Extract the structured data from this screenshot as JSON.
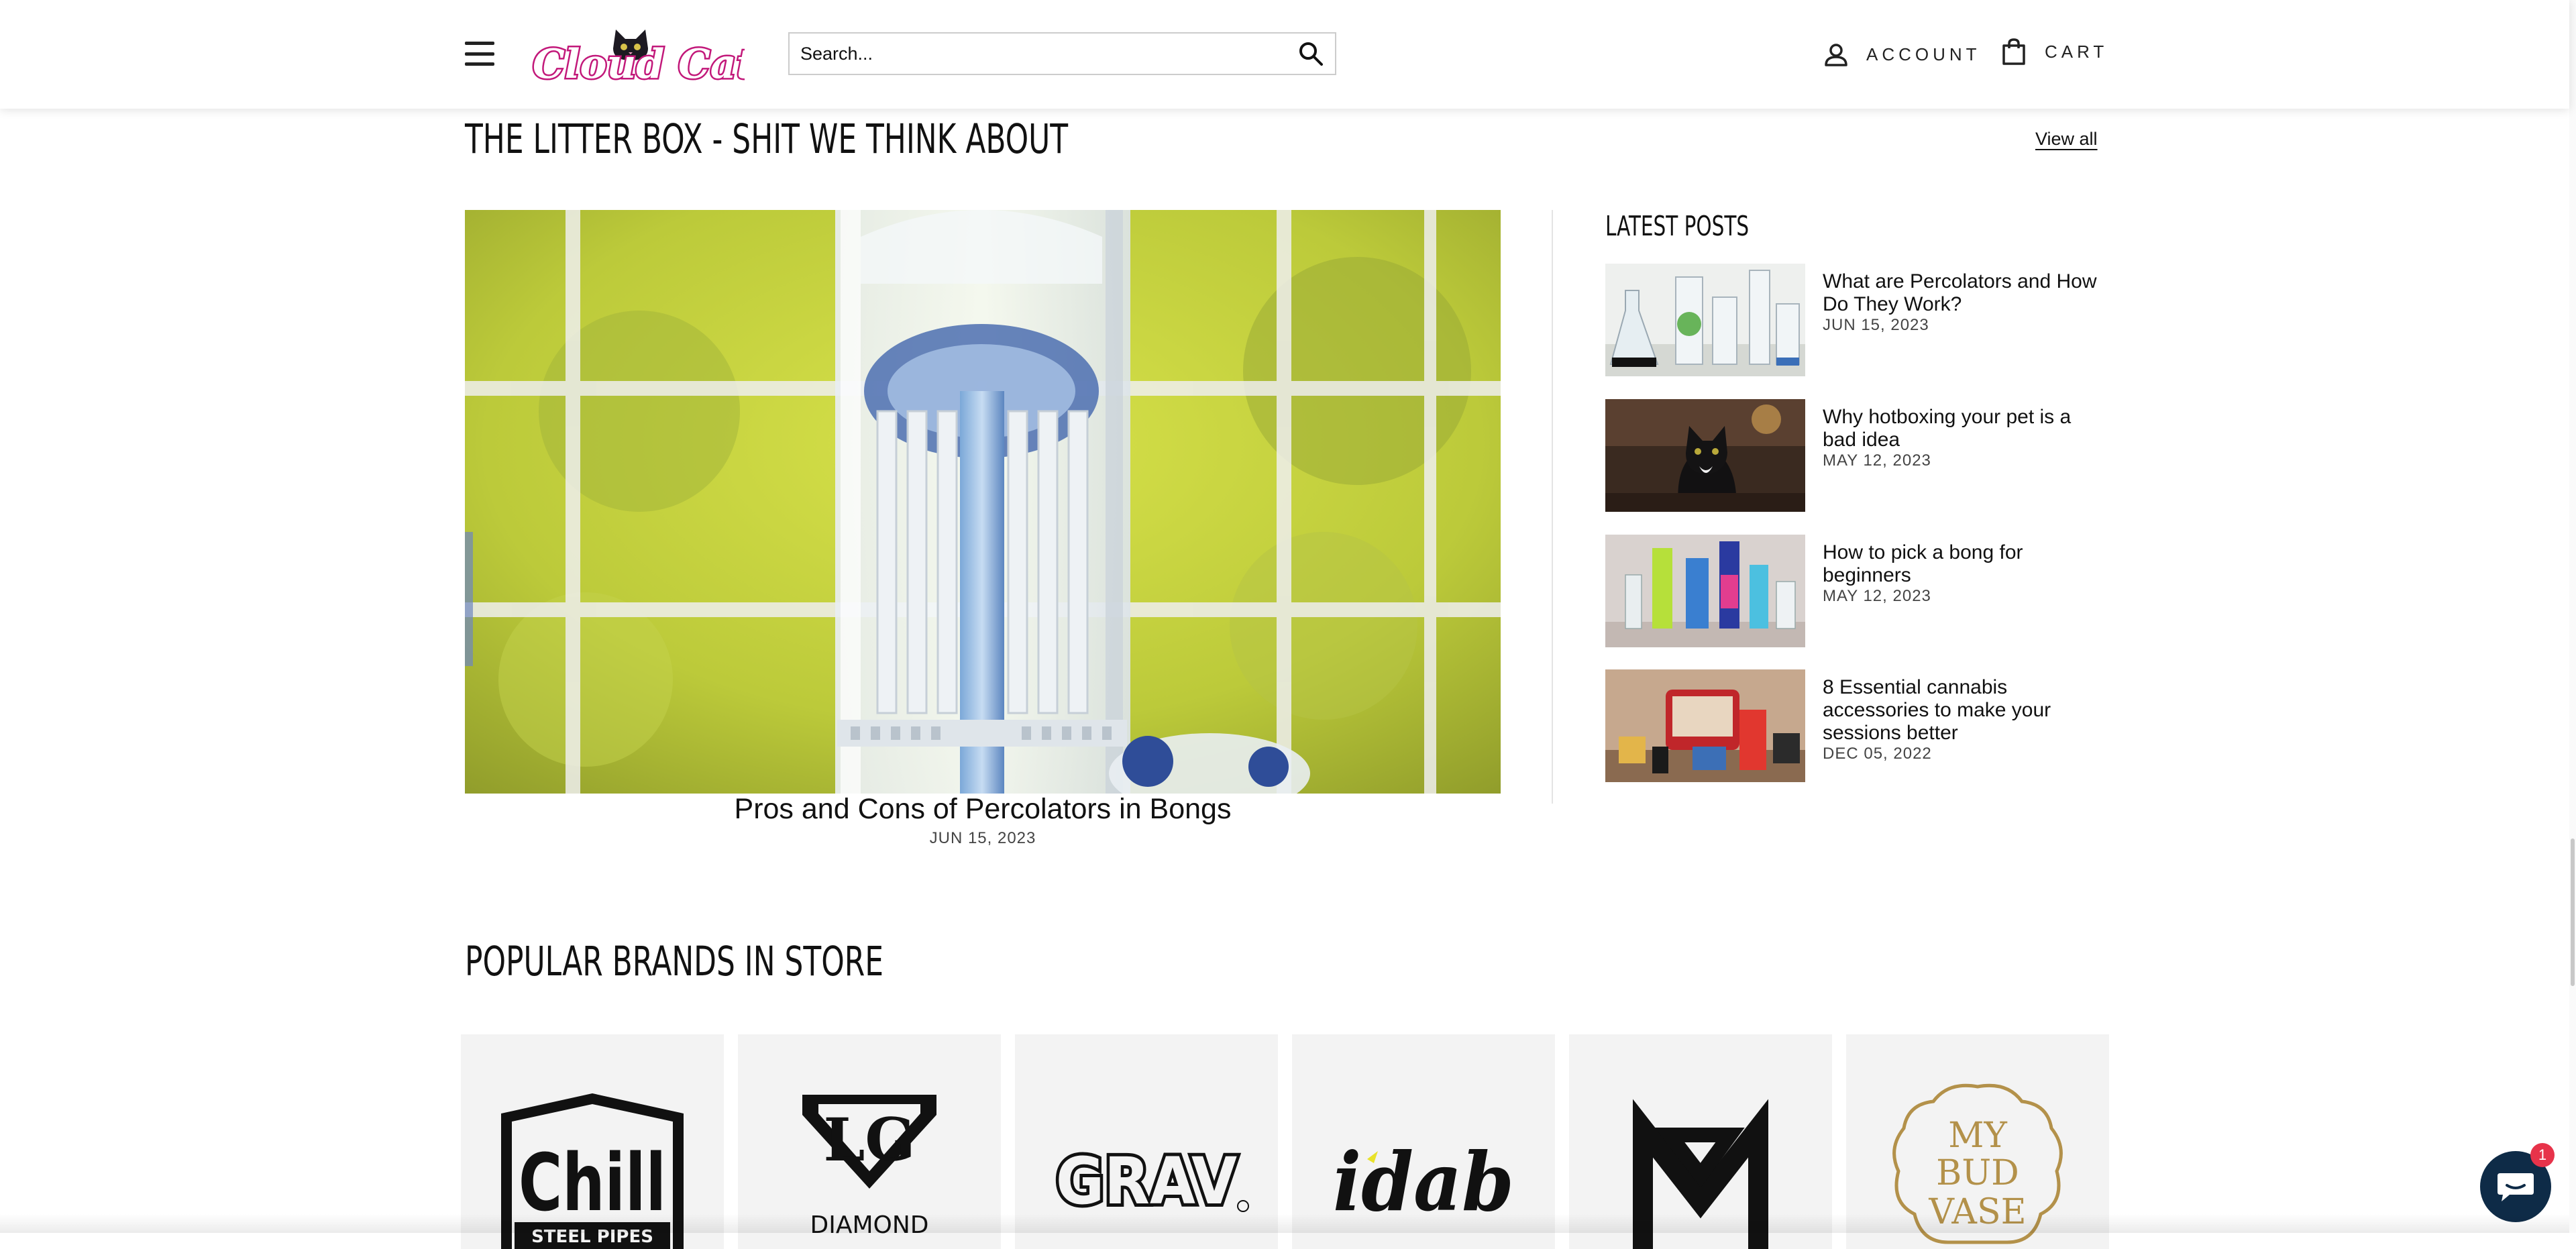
{
  "header": {
    "logo_text": "Cloud Cat",
    "search_placeholder": "Search...",
    "account_label": "ACCOUNT",
    "cart_label": "CART"
  },
  "blog": {
    "title": "THE LITTER BOX - SHIT WE THINK ABOUT",
    "view_all": "View all",
    "featured": {
      "title": "Pros and Cons of Percolators in Bongs",
      "date": "JUN 15, 2023"
    },
    "latest_title": "LATEST POSTS",
    "posts": [
      {
        "title": "What are Percolators and How Do They Work?",
        "date": "JUN 15, 2023"
      },
      {
        "title": "Why hotboxing your pet is a bad idea",
        "date": "MAY 12, 2023"
      },
      {
        "title": "How to pick a bong for beginners",
        "date": "MAY 12, 2023"
      },
      {
        "title": "8 Essential cannabis accessories to make your sessions better",
        "date": "DEC 05, 2022"
      }
    ]
  },
  "brands": {
    "title": "POPULAR BRANDS IN STORE",
    "items": [
      {
        "name": "chill",
        "text_main": "Chill",
        "text_sub": "STEEL PIPES"
      },
      {
        "name": "diamond-glass",
        "text_main": "LG",
        "text_sub": "DIAMOND"
      },
      {
        "name": "grav",
        "text_main": "GRAV",
        "text_sub": ""
      },
      {
        "name": "idab",
        "text_main": "idab",
        "text_sub": ""
      },
      {
        "name": "mj-arsenal",
        "text_main": "MJ",
        "text_sub": ""
      },
      {
        "name": "my-bud-vase",
        "text_main": "MY BUD VASE",
        "text_sub": ""
      }
    ]
  },
  "chat": {
    "badge_count": "1"
  },
  "colors": {
    "accent": "#0e2b47",
    "badge": "#e7334a",
    "logo_pink": "#c2187a",
    "nav_text": "#222222"
  }
}
